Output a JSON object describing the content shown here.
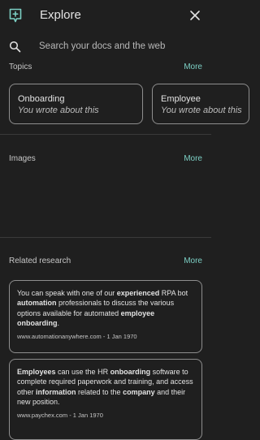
{
  "header": {
    "title": "Explore"
  },
  "search": {
    "placeholder": "Search your docs and the web"
  },
  "topics": {
    "title": "Topics",
    "more_label": "More",
    "cards": [
      {
        "title": "Onboarding",
        "subtitle": "You wrote about this"
      },
      {
        "title": "Employee",
        "subtitle": "You wrote about this"
      }
    ]
  },
  "images": {
    "title": "Images",
    "more_label": "More"
  },
  "related": {
    "title": "Related research",
    "more_label": "More",
    "results": [
      {
        "segments": [
          {
            "text": "You can speak with one of our ",
            "bold": false
          },
          {
            "text": "experienced",
            "bold": true
          },
          {
            "text": " RPA bot ",
            "bold": false
          },
          {
            "text": "automation",
            "bold": true
          },
          {
            "text": " professionals to discuss the various options available for automated ",
            "bold": false
          },
          {
            "text": "employee onboarding",
            "bold": true
          },
          {
            "text": ".",
            "bold": false
          }
        ],
        "source": "www.automationanywhere.com",
        "date": "1 Jan 1970"
      },
      {
        "segments": [
          {
            "text": "Employees",
            "bold": true
          },
          {
            "text": " can use the HR ",
            "bold": false
          },
          {
            "text": "onboarding",
            "bold": true
          },
          {
            "text": " software to complete required paperwork and training, and access other ",
            "bold": false
          },
          {
            "text": "information",
            "bold": true
          },
          {
            "text": " related to the ",
            "bold": false
          },
          {
            "text": "company",
            "bold": true
          },
          {
            "text": " and their new position.",
            "bold": false
          }
        ],
        "source": "www.paychex.com",
        "date": "1 Jan 1970"
      }
    ]
  }
}
